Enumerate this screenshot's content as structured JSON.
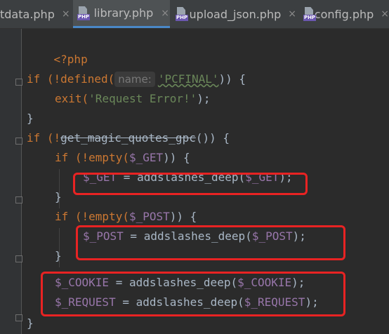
{
  "tabs": [
    {
      "label": "tdata.php",
      "icon": "php-file-icon",
      "active": false
    },
    {
      "label": "library.php",
      "icon": "php-file-icon",
      "active": true
    },
    {
      "label": "upload_json.php",
      "icon": "php-file-icon",
      "active": false
    },
    {
      "label": "config.php",
      "icon": "php-file-icon",
      "active": false
    }
  ],
  "close_glyph": "×",
  "php_badge": "PHP",
  "code": {
    "open_tag": "<?php",
    "if_defined": "if (!defined(",
    "hint_name": "name:",
    "pcfinal": "'PCFINAL'",
    "if_defined_end": ")) {",
    "exit_fn": "exit(",
    "exit_str": "'Request Error!'",
    "exit_end": ");",
    "close_brace": "}",
    "if_magic": "if (!",
    "magic_fn": "get_magic_quotes_gpc",
    "magic_end": "()) {",
    "if_empty_get": "if (!empty(",
    "get_var": "$_GET",
    "if_empty_end": ")) {",
    "get_assign_lhs": "$_GET",
    "assign_mid": " = addslashes_deep(",
    "get_assign_rhs": "$_GET",
    "stmt_end": ");",
    "if_empty_post": "if (!empty(",
    "post_var": "$_POST",
    "post_assign_lhs": "$_POST",
    "post_assign_rhs": "$_POST",
    "cookie_lhs": "$_COOKIE",
    "cookie_rhs": "$_COOKIE",
    "request_lhs": "$_REQUEST",
    "request_rhs": "$_REQUEST"
  },
  "colors": {
    "background": "#2b2b2b",
    "keyword": "#cc7832",
    "string": "#6a8759",
    "variable": "#9876aa",
    "highlight_box": "#e82323"
  }
}
